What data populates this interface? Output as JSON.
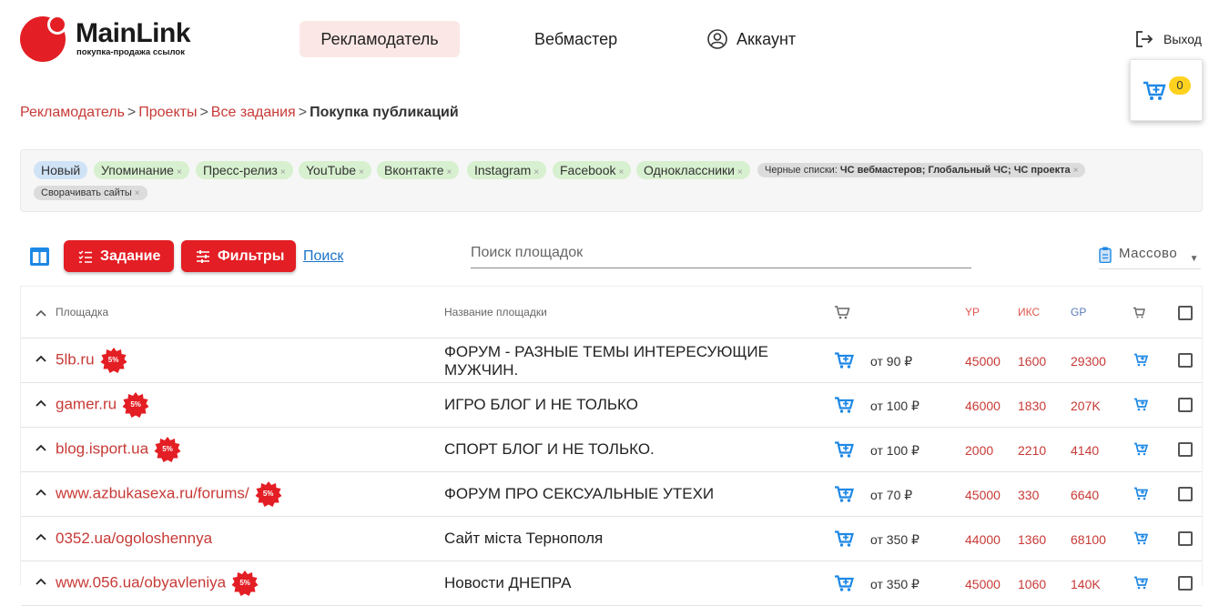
{
  "header": {
    "logo_text": "MainLink",
    "logo_sub": "покупка-продажа ссылок",
    "nav": {
      "advertiser": "Рекламодатель",
      "webmaster": "Вебмастер",
      "account": "Аккаунт"
    },
    "logout": "Выход",
    "cart_count": "0"
  },
  "breadcrumb": {
    "items": [
      "Рекламодатель",
      "Проекты",
      "Все задания"
    ],
    "separator": ">",
    "current": "Покупка публикаций"
  },
  "tags": {
    "new": "Новый",
    "mention": "Упоминание",
    "press": "Пресс-релиз",
    "youtube": "YouTube",
    "vk": "Вконтакте",
    "instagram": "Instagram",
    "facebook": "Facebook",
    "ok": "Одноклассники",
    "blacklist_label": "Черные списки:",
    "blacklist_value": "ЧС вебмастеров; Глобальный ЧС; ЧС проекта",
    "collapse": "Сворачивать сайты",
    "close_glyph": "×"
  },
  "toolbar": {
    "task_label": "Задание",
    "filters_label": "Фильтры",
    "search_link": "Поиск",
    "search_placeholder": "Поиск площадок",
    "mass_label": "Массово"
  },
  "table": {
    "headers": {
      "site": "Площадка",
      "name": "Название площадки",
      "ya": "YP",
      "iks": "ИКС",
      "gp": "GP"
    },
    "discount": "5%",
    "rows": [
      {
        "site": "5lb.ru",
        "discount": true,
        "name": "ФОРУМ - РАЗНЫЕ ТЕМЫ ИНТЕРЕСУЮЩИЕ",
        "name2": "МУЖЧИН.",
        "price": "от 90 ₽",
        "ya": "45000",
        "iks": "1600",
        "gp": "29300"
      },
      {
        "site": "gamer.ru",
        "discount": true,
        "name": "ИГРО БЛОГ И НЕ ТОЛЬКО",
        "name2": "",
        "price": "от 100 ₽",
        "ya": "46000",
        "iks": "1830",
        "gp": "207K"
      },
      {
        "site": "blog.isport.ua",
        "discount": true,
        "name": "СПОРТ БЛОГ И НЕ ТОЛЬКО.",
        "name2": "",
        "price": "от 100 ₽",
        "ya": "2000",
        "iks": "2210",
        "gp": "4140"
      },
      {
        "site": "www.azbukasexa.ru/forums/",
        "discount": true,
        "name": "ФОРУМ ПРО СЕКСУАЛЬНЫЕ УТЕХИ",
        "name2": "",
        "price": "от 70 ₽",
        "ya": "45000",
        "iks": "330",
        "gp": "6640"
      },
      {
        "site": "0352.ua/ogoloshennya",
        "discount": false,
        "name": "Сайт міста Тернополя",
        "name2": "",
        "price": "от 350 ₽",
        "ya": "44000",
        "iks": "1360",
        "gp": "68100"
      },
      {
        "site": "www.056.ua/obyavleniya",
        "discount": true,
        "name": "Новости ДНЕПРА",
        "name2": "",
        "price": "от 350 ₽",
        "ya": "45000",
        "iks": "1060",
        "gp": "140K"
      }
    ]
  },
  "colors": {
    "brand_red": "#e31e24",
    "link_red": "#c73a36",
    "cart_blue": "#1e88e5",
    "badge_yellow": "#ffd21f"
  }
}
